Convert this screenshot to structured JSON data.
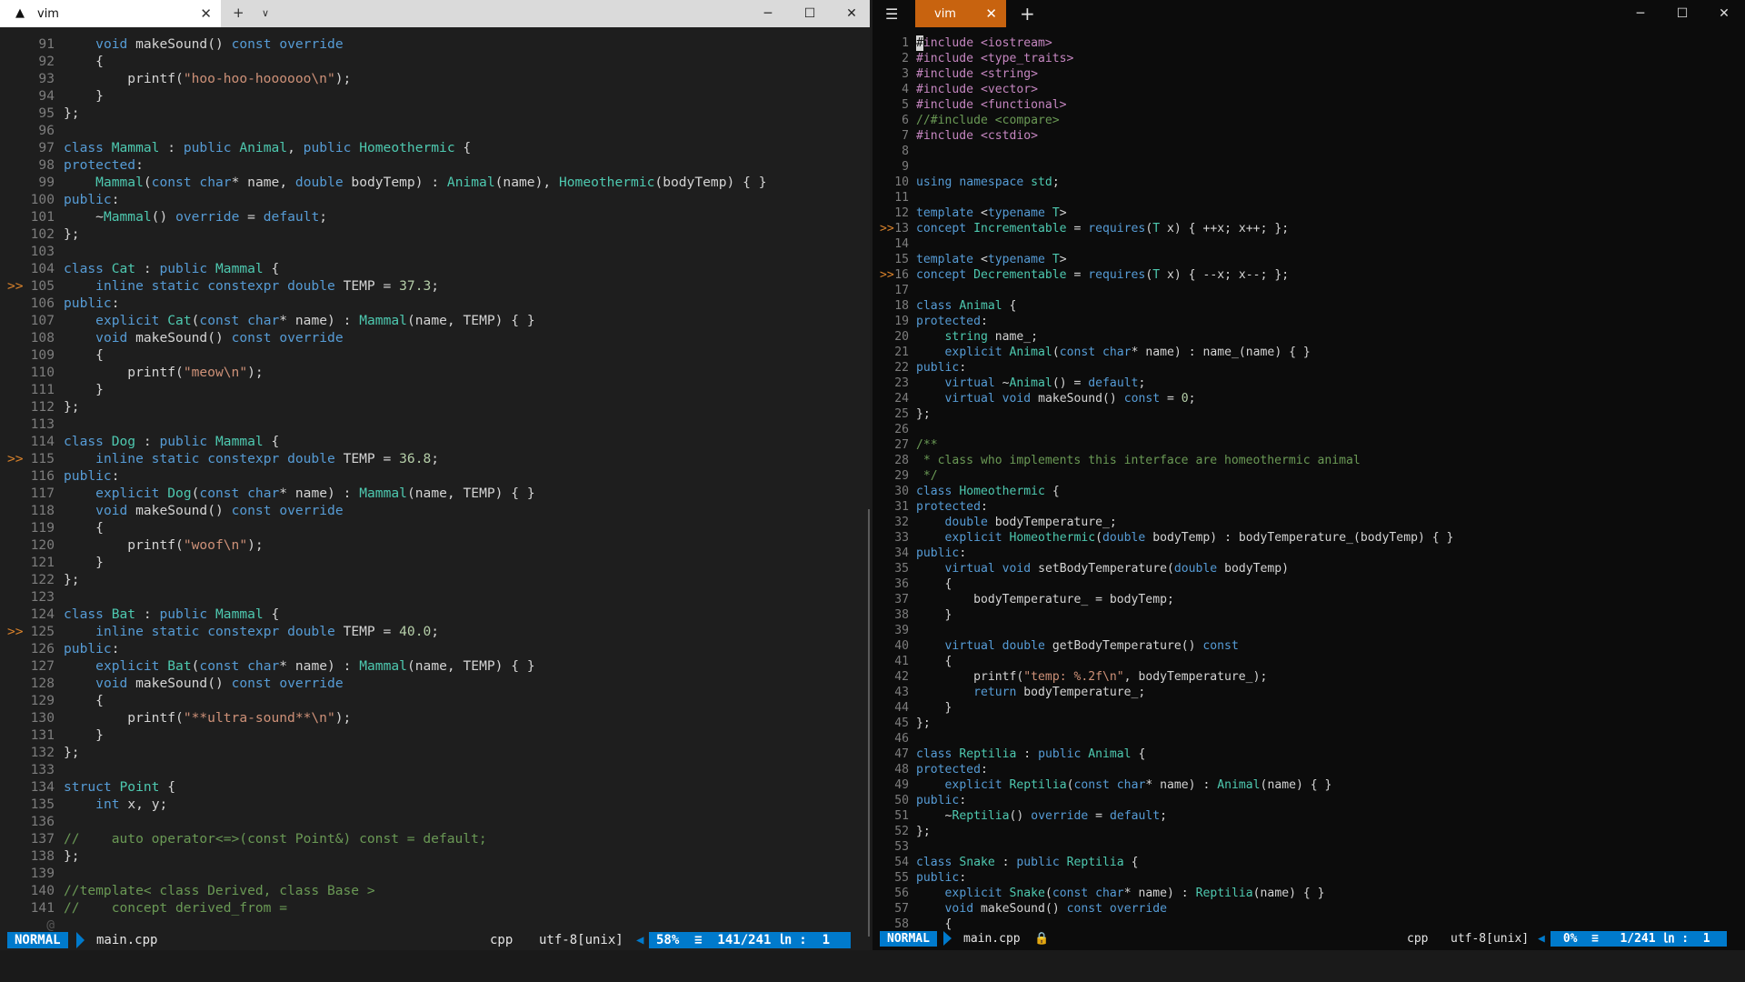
{
  "left_window": {
    "tab_title": "vim",
    "code_lines": [
      {
        "sign": "",
        "num": "91",
        "text": "    void makeSound() const override"
      },
      {
        "sign": "",
        "num": "92",
        "text": "    {"
      },
      {
        "sign": "",
        "num": "93",
        "text": "        printf(\"hoo-hoo-hoooooo\\n\");"
      },
      {
        "sign": "",
        "num": "94",
        "text": "    }"
      },
      {
        "sign": "",
        "num": "95",
        "text": "};"
      },
      {
        "sign": "",
        "num": "96",
        "text": ""
      },
      {
        "sign": "",
        "num": "97",
        "text": "class Mammal : public Animal, public Homeothermic {"
      },
      {
        "sign": "",
        "num": "98",
        "text": "protected:"
      },
      {
        "sign": "",
        "num": "99",
        "text": "    Mammal(const char* name, double bodyTemp) : Animal(name), Homeothermic(bodyTemp) { }"
      },
      {
        "sign": "",
        "num": "100",
        "text": "public:"
      },
      {
        "sign": "",
        "num": "101",
        "text": "    ~Mammal() override = default;"
      },
      {
        "sign": "",
        "num": "102",
        "text": "};"
      },
      {
        "sign": "",
        "num": "103",
        "text": ""
      },
      {
        "sign": "",
        "num": "104",
        "text": "class Cat : public Mammal {"
      },
      {
        "sign": ">>",
        "num": "105",
        "text": "    inline static constexpr double TEMP = 37.3;"
      },
      {
        "sign": "",
        "num": "106",
        "text": "public:"
      },
      {
        "sign": "",
        "num": "107",
        "text": "    explicit Cat(const char* name) : Mammal(name, TEMP) { }"
      },
      {
        "sign": "",
        "num": "108",
        "text": "    void makeSound() const override"
      },
      {
        "sign": "",
        "num": "109",
        "text": "    {"
      },
      {
        "sign": "",
        "num": "110",
        "text": "        printf(\"meow\\n\");"
      },
      {
        "sign": "",
        "num": "111",
        "text": "    }"
      },
      {
        "sign": "",
        "num": "112",
        "text": "};"
      },
      {
        "sign": "",
        "num": "113",
        "text": ""
      },
      {
        "sign": "",
        "num": "114",
        "text": "class Dog : public Mammal {"
      },
      {
        "sign": ">>",
        "num": "115",
        "text": "    inline static constexpr double TEMP = 36.8;"
      },
      {
        "sign": "",
        "num": "116",
        "text": "public:"
      },
      {
        "sign": "",
        "num": "117",
        "text": "    explicit Dog(const char* name) : Mammal(name, TEMP) { }"
      },
      {
        "sign": "",
        "num": "118",
        "text": "    void makeSound() const override"
      },
      {
        "sign": "",
        "num": "119",
        "text": "    {"
      },
      {
        "sign": "",
        "num": "120",
        "text": "        printf(\"woof\\n\");"
      },
      {
        "sign": "",
        "num": "121",
        "text": "    }"
      },
      {
        "sign": "",
        "num": "122",
        "text": "};"
      },
      {
        "sign": "",
        "num": "123",
        "text": ""
      },
      {
        "sign": "",
        "num": "124",
        "text": "class Bat : public Mammal {"
      },
      {
        "sign": ">>",
        "num": "125",
        "text": "    inline static constexpr double TEMP = 40.0;"
      },
      {
        "sign": "",
        "num": "126",
        "text": "public:"
      },
      {
        "sign": "",
        "num": "127",
        "text": "    explicit Bat(const char* name) : Mammal(name, TEMP) { }"
      },
      {
        "sign": "",
        "num": "128",
        "text": "    void makeSound() const override"
      },
      {
        "sign": "",
        "num": "129",
        "text": "    {"
      },
      {
        "sign": "",
        "num": "130",
        "text": "        printf(\"**ultra-sound**\\n\");"
      },
      {
        "sign": "",
        "num": "131",
        "text": "    }"
      },
      {
        "sign": "",
        "num": "132",
        "text": "};"
      },
      {
        "sign": "",
        "num": "133",
        "text": ""
      },
      {
        "sign": "",
        "num": "134",
        "text": "struct Point {"
      },
      {
        "sign": "",
        "num": "135",
        "text": "    int x, y;"
      },
      {
        "sign": "",
        "num": "136",
        "text": ""
      },
      {
        "sign": "",
        "num": "137",
        "text": "//    auto operator<=>(const Point&) const = default;"
      },
      {
        "sign": "",
        "num": "138",
        "text": "};"
      },
      {
        "sign": "",
        "num": "139",
        "text": ""
      },
      {
        "sign": "",
        "num": "140",
        "text": "//template< class Derived, class Base >"
      },
      {
        "sign": "",
        "num": "141",
        "text": "//    concept derived_from ="
      },
      {
        "sign": "",
        "num": "@",
        "text": ""
      }
    ],
    "status": {
      "mode": "NORMAL",
      "file": "main.cpp",
      "filetype": "cpp",
      "encoding": "utf-8[unix]",
      "position": "58%  ≡  141/241 ㏑ :  1"
    }
  },
  "right_window": {
    "tab_title": "vim",
    "code_lines": [
      {
        "sign": "",
        "num": "1",
        "text": "#include <iostream>"
      },
      {
        "sign": "",
        "num": "2",
        "text": "#include <type_traits>"
      },
      {
        "sign": "",
        "num": "3",
        "text": "#include <string>"
      },
      {
        "sign": "",
        "num": "4",
        "text": "#include <vector>"
      },
      {
        "sign": "",
        "num": "5",
        "text": "#include <functional>"
      },
      {
        "sign": "",
        "num": "6",
        "text": "//#include <compare>"
      },
      {
        "sign": "",
        "num": "7",
        "text": "#include <cstdio>"
      },
      {
        "sign": "",
        "num": "8",
        "text": ""
      },
      {
        "sign": "",
        "num": "9",
        "text": ""
      },
      {
        "sign": "",
        "num": "10",
        "text": "using namespace std;"
      },
      {
        "sign": "",
        "num": "11",
        "text": ""
      },
      {
        "sign": "",
        "num": "12",
        "text": "template <typename T>"
      },
      {
        "sign": ">>",
        "num": "13",
        "text": "concept Incrementable = requires(T x) { ++x; x++; };"
      },
      {
        "sign": "",
        "num": "14",
        "text": ""
      },
      {
        "sign": "",
        "num": "15",
        "text": "template <typename T>"
      },
      {
        "sign": ">>",
        "num": "16",
        "text": "concept Decrementable = requires(T x) { --x; x--; };"
      },
      {
        "sign": "",
        "num": "17",
        "text": ""
      },
      {
        "sign": "",
        "num": "18",
        "text": "class Animal {"
      },
      {
        "sign": "",
        "num": "19",
        "text": "protected:"
      },
      {
        "sign": "",
        "num": "20",
        "text": "    string name_;"
      },
      {
        "sign": "",
        "num": "21",
        "text": "    explicit Animal(const char* name) : name_(name) { }"
      },
      {
        "sign": "",
        "num": "22",
        "text": "public:"
      },
      {
        "sign": "",
        "num": "23",
        "text": "    virtual ~Animal() = default;"
      },
      {
        "sign": "",
        "num": "24",
        "text": "    virtual void makeSound() const = 0;"
      },
      {
        "sign": "",
        "num": "25",
        "text": "};"
      },
      {
        "sign": "",
        "num": "26",
        "text": ""
      },
      {
        "sign": "",
        "num": "27",
        "text": "/**"
      },
      {
        "sign": "",
        "num": "28",
        "text": " * class who implements this interface are homeothermic animal"
      },
      {
        "sign": "",
        "num": "29",
        "text": " */"
      },
      {
        "sign": "",
        "num": "30",
        "text": "class Homeothermic {"
      },
      {
        "sign": "",
        "num": "31",
        "text": "protected:"
      },
      {
        "sign": "",
        "num": "32",
        "text": "    double bodyTemperature_;"
      },
      {
        "sign": "",
        "num": "33",
        "text": "    explicit Homeothermic(double bodyTemp) : bodyTemperature_(bodyTemp) { }"
      },
      {
        "sign": "",
        "num": "34",
        "text": "public:"
      },
      {
        "sign": "",
        "num": "35",
        "text": "    virtual void setBodyTemperature(double bodyTemp)"
      },
      {
        "sign": "",
        "num": "36",
        "text": "    {"
      },
      {
        "sign": "",
        "num": "37",
        "text": "        bodyTemperature_ = bodyTemp;"
      },
      {
        "sign": "",
        "num": "38",
        "text": "    }"
      },
      {
        "sign": "",
        "num": "39",
        "text": ""
      },
      {
        "sign": "",
        "num": "40",
        "text": "    virtual double getBodyTemperature() const"
      },
      {
        "sign": "",
        "num": "41",
        "text": "    {"
      },
      {
        "sign": "",
        "num": "42",
        "text": "        printf(\"temp: %.2f\\n\", bodyTemperature_);"
      },
      {
        "sign": "",
        "num": "43",
        "text": "        return bodyTemperature_;"
      },
      {
        "sign": "",
        "num": "44",
        "text": "    }"
      },
      {
        "sign": "",
        "num": "45",
        "text": "};"
      },
      {
        "sign": "",
        "num": "46",
        "text": ""
      },
      {
        "sign": "",
        "num": "47",
        "text": "class Reptilia : public Animal {"
      },
      {
        "sign": "",
        "num": "48",
        "text": "protected:"
      },
      {
        "sign": "",
        "num": "49",
        "text": "    explicit Reptilia(const char* name) : Animal(name) { }"
      },
      {
        "sign": "",
        "num": "50",
        "text": "public:"
      },
      {
        "sign": "",
        "num": "51",
        "text": "    ~Reptilia() override = default;"
      },
      {
        "sign": "",
        "num": "52",
        "text": "};"
      },
      {
        "sign": "",
        "num": "53",
        "text": ""
      },
      {
        "sign": "",
        "num": "54",
        "text": "class Snake : public Reptilia {"
      },
      {
        "sign": "",
        "num": "55",
        "text": "public:"
      },
      {
        "sign": "",
        "num": "56",
        "text": "    explicit Snake(const char* name) : Reptilia(name) { }"
      },
      {
        "sign": "",
        "num": "57",
        "text": "    void makeSound() const override"
      },
      {
        "sign": "",
        "num": "58",
        "text": "    {"
      }
    ],
    "status": {
      "mode": "NORMAL",
      "file": "main.cpp",
      "filetype": "cpp",
      "encoding": "utf-8[unix]",
      "position": " 0%  ≡   1/241 ㏑ :  1"
    }
  },
  "colors": {
    "keyword": "#569cd6",
    "type": "#4ec9b0",
    "string": "#ce9178",
    "comment": "#6a9955",
    "preproc": "#c586c0",
    "number": "#b5cea8",
    "text": "#d4d4d4",
    "linenr": "#7d7d7d",
    "sign": "#d9822b",
    "status_accent": "#007acc",
    "tab_active_right": "#c8630f"
  },
  "icons": {
    "app": "vim-logo-icon",
    "new_tab": "plus-icon",
    "tab_dropdown": "chevron-down-icon",
    "minimize": "minimize-icon",
    "maximize": "maximize-icon",
    "close": "close-icon",
    "menu": "hamburger-menu-icon",
    "readonly": "lock-icon"
  }
}
